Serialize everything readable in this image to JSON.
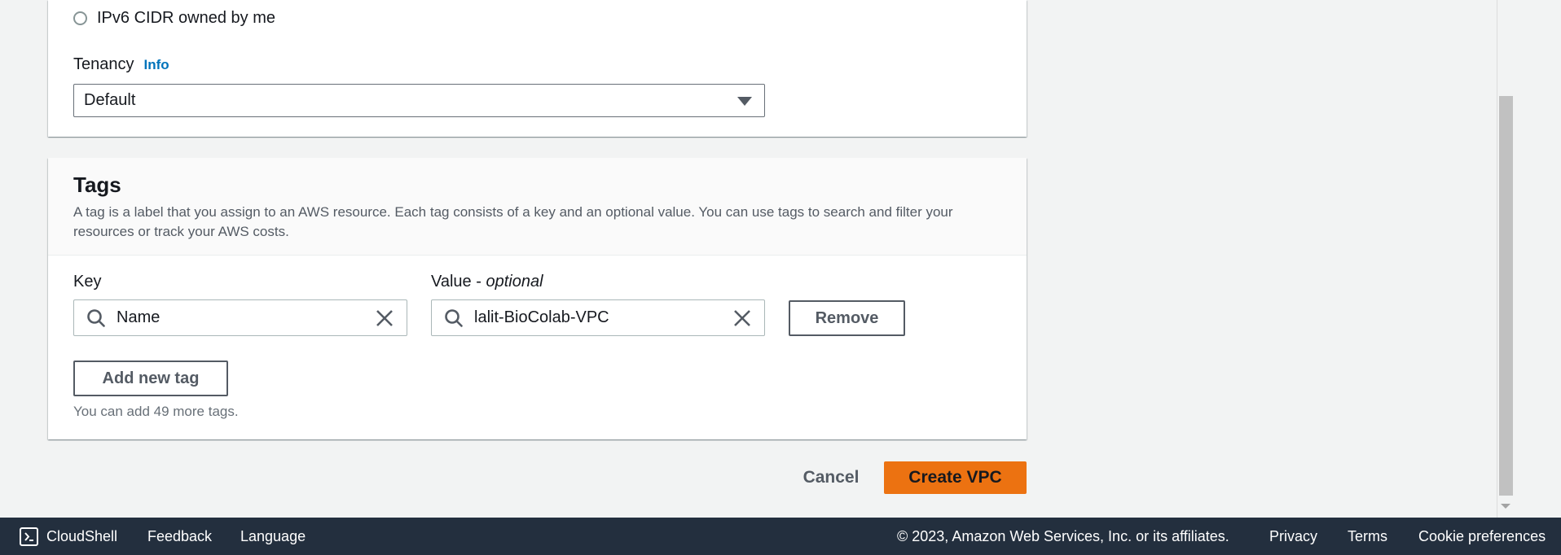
{
  "ipv6_option": {
    "label": "IPv6 CIDR owned by me"
  },
  "tenancy": {
    "label": "Tenancy",
    "info": "Info",
    "value": "Default"
  },
  "tags": {
    "title": "Tags",
    "description": "A tag is a label that you assign to an AWS resource. Each tag consists of a key and an optional value. You can use tags to search and filter your resources or track your AWS costs.",
    "key_label": "Key",
    "value_label_prefix": "Value - ",
    "value_label_suffix": "optional",
    "rows": [
      {
        "key": "Name",
        "value": "lalit-BioColab-VPC"
      }
    ],
    "remove_label": "Remove",
    "add_label": "Add new tag",
    "hint": "You can add 49 more tags."
  },
  "actions": {
    "cancel": "Cancel",
    "create": "Create VPC"
  },
  "footer": {
    "cloudshell": "CloudShell",
    "feedback": "Feedback",
    "language": "Language",
    "copyright": "© 2023, Amazon Web Services, Inc. or its affiliates.",
    "privacy": "Privacy",
    "terms": "Terms",
    "cookies": "Cookie preferences"
  },
  "colors": {
    "primary": "#ec7211",
    "link": "#0073bb",
    "footer_bg": "#232f3e"
  },
  "icons": [
    "search-icon",
    "clear-icon",
    "caret-down-icon",
    "cloudshell-icon"
  ]
}
